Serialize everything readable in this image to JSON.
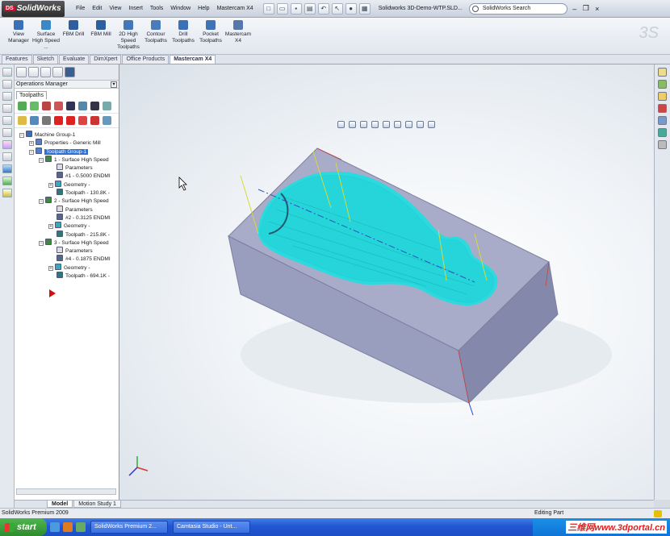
{
  "app": {
    "logo_text": "SolidWorks",
    "doc_title": "Solidworks 3D-Demo-WTP.SLD...",
    "search_placeholder": "SolidWorks Search"
  },
  "menus": [
    "File",
    "Edit",
    "View",
    "Insert",
    "Tools",
    "Window",
    "Help",
    "Mastercam X4"
  ],
  "ribbon": {
    "buttons": [
      {
        "label": "View Manager",
        "color": "#3b6fb6"
      },
      {
        "label": "Surface High Speed ...",
        "color": "#3b88c8"
      },
      {
        "label": "FBM Drill",
        "color": "#2d5e9e"
      },
      {
        "label": "FBM Mill",
        "color": "#2d5e9e"
      },
      {
        "label": "2D High Speed Toolpaths",
        "color": "#4377b8"
      },
      {
        "label": "Contour Toolpaths",
        "color": "#4a7cbc"
      },
      {
        "label": "Drill Toolpaths",
        "color": "#3b6fb6"
      },
      {
        "label": "Pocket Toolpaths",
        "color": "#3f73b6"
      },
      {
        "label": "Mastercam X4",
        "color": "#5577aa"
      }
    ]
  },
  "tabs": [
    "Features",
    "Sketch",
    "Evaluate",
    "DimXpert",
    "Office Products",
    "Mastercam X4"
  ],
  "ops": {
    "title": "Operations Manager",
    "tab": "Toolpaths",
    "tree": [
      {
        "label": "Machine Group-1",
        "indent": 0,
        "icon_color": "#3a6fb5"
      },
      {
        "label": "Properties - Generic Mill",
        "indent": 1,
        "icon_color": "#5a7fc0"
      },
      {
        "label": "Toolpath Group-1",
        "indent": 1,
        "icon_color": "#4d7fd0",
        "selected": true
      },
      {
        "label": "1 - Surface High Speed",
        "indent": 2,
        "icon_color": "#3c8a3c"
      },
      {
        "label": "Parameters",
        "indent": 3,
        "icon_color": "#dddddd"
      },
      {
        "label": "#1 - 0.5000 ENDMI",
        "indent": 3,
        "icon_color": "#556688"
      },
      {
        "label": "Geometry -",
        "indent": 3,
        "icon_color": "#3aa8b8"
      },
      {
        "label": "Toolpath - 130.8K -",
        "indent": 3,
        "icon_color": "#2a7a7a"
      },
      {
        "label": "2 - Surface High Speed",
        "indent": 2,
        "icon_color": "#3c8a3c"
      },
      {
        "label": "Parameters",
        "indent": 3,
        "icon_color": "#dddddd"
      },
      {
        "label": "#2 - 0.3125 ENDMI",
        "indent": 3,
        "icon_color": "#556688"
      },
      {
        "label": "Geometry -",
        "indent": 3,
        "icon_color": "#3aa8b8"
      },
      {
        "label": "Toolpath - 215.8K -",
        "indent": 3,
        "icon_color": "#2a7a7a"
      },
      {
        "label": "3 - Surface High Speed",
        "indent": 2,
        "icon_color": "#3c8a3c"
      },
      {
        "label": "Parameters",
        "indent": 3,
        "icon_color": "#dddddd"
      },
      {
        "label": "#4 - 0.1875 ENDMI",
        "indent": 3,
        "icon_color": "#556688"
      },
      {
        "label": "Geometry -",
        "indent": 3,
        "icon_color": "#3aa8b8"
      },
      {
        "label": "Toolpath - 694.1K -",
        "indent": 3,
        "icon_color": "#2a7a7a"
      }
    ]
  },
  "bottom_tabs": [
    "Model",
    "Motion Study 1"
  ],
  "status": {
    "left": "SolidWorks Premium 2009",
    "right": "Editing Part"
  },
  "taskbar": {
    "start": "start",
    "tasks": [
      "SolidWorks Premium 2...",
      "Camtasia Studio - Unt..."
    ],
    "watermark": "三维网www.3dportal.cn"
  },
  "colors": {
    "block_top": "#a8acc8",
    "block_front": "#9a9ebe",
    "block_side": "#8488aa",
    "toolpath": "#19e0e0"
  }
}
